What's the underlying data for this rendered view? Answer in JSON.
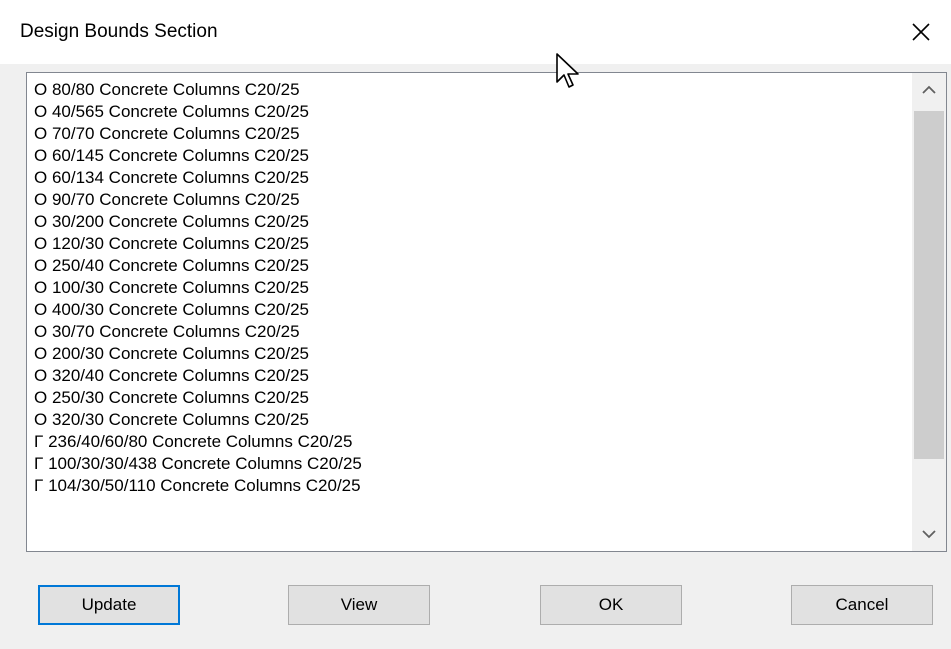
{
  "window": {
    "title": "Design Bounds Section",
    "close_glyph": "✕"
  },
  "list": {
    "items": [
      "O 80/80 Concrete Columns C20/25",
      "O 40/565 Concrete Columns C20/25",
      "O 70/70 Concrete Columns C20/25",
      "O 60/145 Concrete Columns C20/25",
      "O 60/134 Concrete Columns C20/25",
      "O 90/70 Concrete Columns C20/25",
      "O 30/200 Concrete Columns C20/25",
      "O 120/30 Concrete Columns C20/25",
      "O 250/40 Concrete Columns C20/25",
      "O 100/30 Concrete Columns C20/25",
      "O 400/30 Concrete Columns C20/25",
      "O 30/70 Concrete Columns C20/25",
      "O 200/30 Concrete Columns C20/25",
      "O 320/40 Concrete Columns C20/25",
      "O 250/30 Concrete Columns C20/25",
      "O 320/30 Concrete Columns C20/25",
      "Γ 236/40/60/80 Concrete Columns C20/25",
      "Γ 100/30/30/438 Concrete Columns C20/25",
      "Γ 104/30/50/110 Concrete Columns C20/25"
    ]
  },
  "buttons": {
    "update": "Update",
    "view": "View",
    "ok": "OK",
    "cancel": "Cancel"
  },
  "icons": {
    "close": "close-icon",
    "scroll_up": "chevron-up-icon",
    "scroll_down": "chevron-down-icon",
    "cursor": "mouse-pointer-icon"
  },
  "colors": {
    "default_button_border": "#0078d7",
    "title_background": "#ffffff",
    "dialog_background": "#f0f0f0"
  }
}
